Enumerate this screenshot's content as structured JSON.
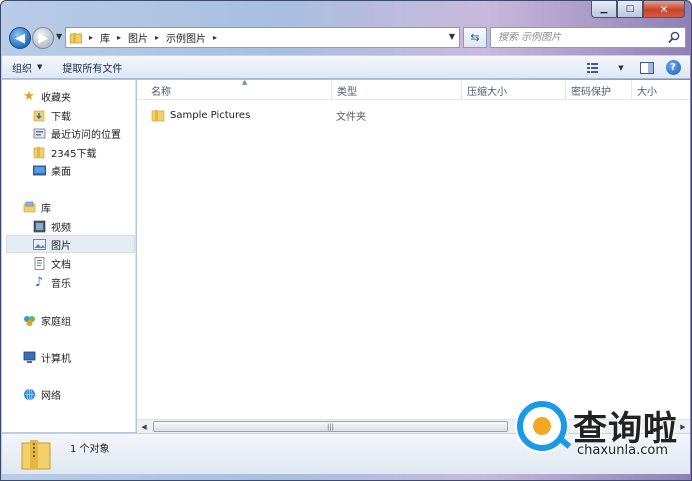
{
  "window": {
    "caption": {
      "minimize": "▁",
      "maximize": "□",
      "close": "✕"
    }
  },
  "address": {
    "crumbs": [
      "库",
      "图片",
      "示例图片"
    ],
    "search_placeholder": "搜索 示例图片"
  },
  "toolbar": {
    "organize_label": "组织",
    "extract_label": "提取所有文件"
  },
  "nav": {
    "favorites": {
      "label": "收藏夹",
      "items": [
        "下载",
        "最近访问的位置",
        "2345下载",
        "桌面"
      ]
    },
    "libraries": {
      "label": "库",
      "items": [
        "视频",
        "图片",
        "文档",
        "音乐"
      ],
      "selected": "图片"
    },
    "homegroup": "家庭组",
    "computer": "计算机",
    "network": "网络"
  },
  "columns": [
    "名称",
    "类型",
    "压缩大小",
    "密码保护",
    "大小"
  ],
  "files": [
    {
      "name": "Sample Pictures",
      "type": "文件夹"
    }
  ],
  "details": {
    "count": "1 个对象"
  },
  "watermark": {
    "title": "查询啦",
    "url": "chaxunla.com"
  },
  "colors": {
    "accent": "#1a9ae6",
    "selection": "#e6ecf4",
    "toolbar": "#dde7f3"
  },
  "icons": [
    "back-icon",
    "forward-icon",
    "folder-icon",
    "refresh-icon",
    "search-icon",
    "view-icon",
    "preview-pane-icon",
    "help-icon",
    "star-icon",
    "library-icon",
    "homegroup-icon",
    "computer-icon",
    "network-icon"
  ]
}
